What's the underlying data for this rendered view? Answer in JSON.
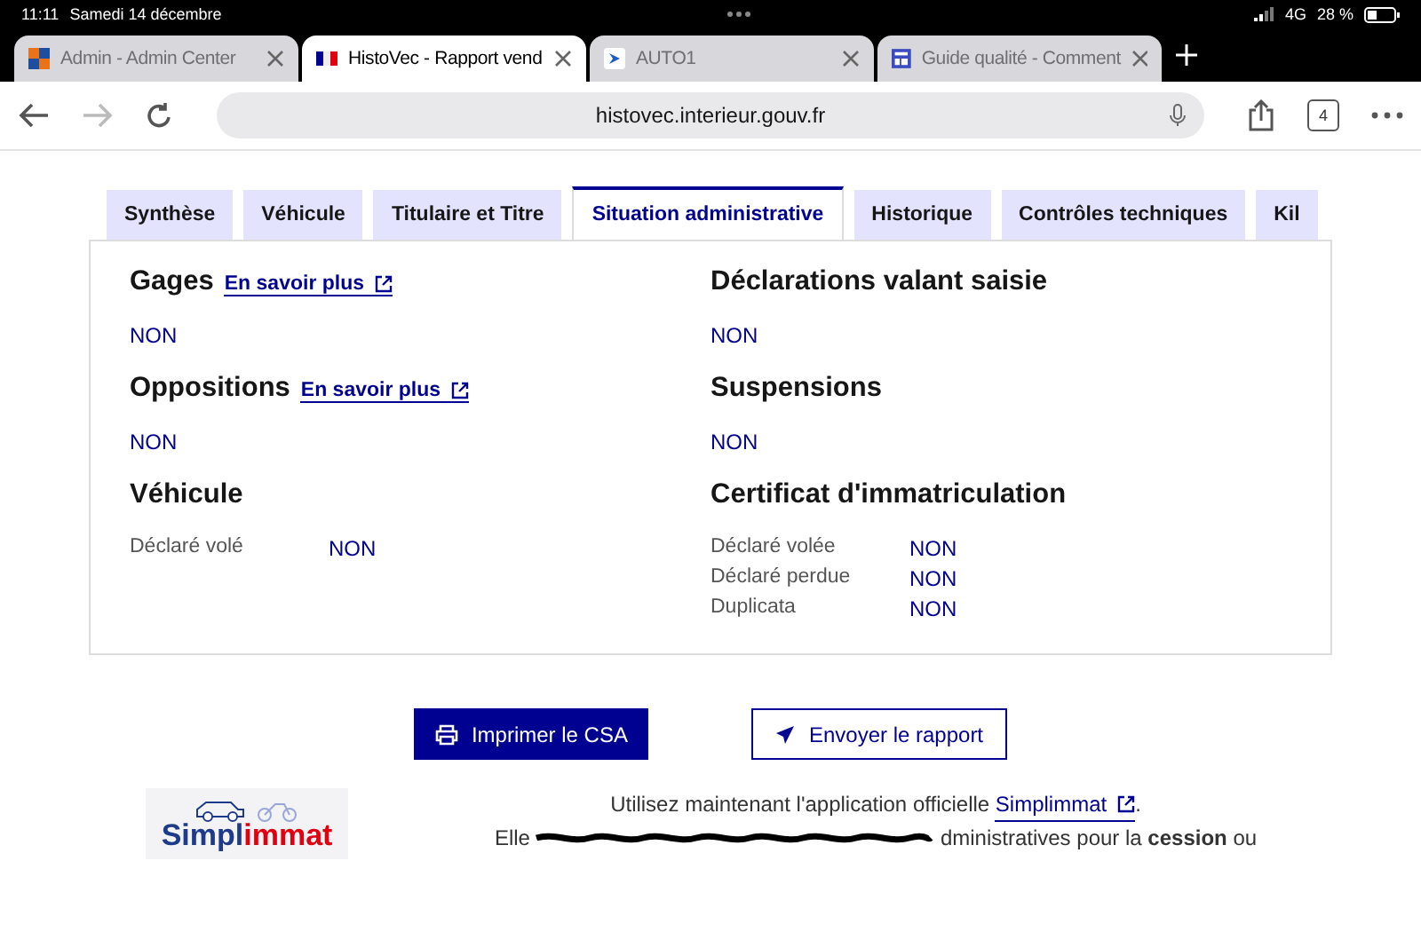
{
  "status_bar": {
    "time": "11:11",
    "date": "Samedi 14 décembre",
    "network": "4G",
    "battery": "28 %"
  },
  "browser_tabs": [
    {
      "title": "Admin - Admin Center",
      "selected": false
    },
    {
      "title": "HistoVec - Rapport vend",
      "selected": true
    },
    {
      "title": "AUTO1",
      "selected": false
    },
    {
      "title": "Guide qualité - Comment",
      "selected": false
    }
  ],
  "address_bar": {
    "url": "histovec.interieur.gouv.fr",
    "tab_count": "4"
  },
  "page_tabs": [
    {
      "label": "Synthèse",
      "selected": false
    },
    {
      "label": "Véhicule",
      "selected": false
    },
    {
      "label": "Titulaire et Titre",
      "selected": false
    },
    {
      "label": "Situation administrative",
      "selected": true
    },
    {
      "label": "Historique",
      "selected": false
    },
    {
      "label": "Contrôles techniques",
      "selected": false
    },
    {
      "label": "Kil",
      "selected": false
    }
  ],
  "columns": [
    {
      "sections": [
        {
          "title": "Gages",
          "link": "En savoir plus",
          "value": "NON"
        },
        {
          "title": "Oppositions",
          "link": "En savoir plus",
          "value": "NON"
        },
        {
          "title": "Véhicule",
          "rows": [
            {
              "label": "Déclaré volé",
              "value": "NON"
            }
          ]
        }
      ]
    },
    {
      "sections": [
        {
          "title": "Déclarations valant saisie",
          "value": "NON"
        },
        {
          "title": "Suspensions",
          "value": "NON"
        },
        {
          "title": "Certificat d'immatriculation",
          "rows": [
            {
              "label": "Déclaré volée",
              "value": "NON"
            },
            {
              "label": "Déclaré perdue",
              "value": "NON"
            },
            {
              "label": "Duplicata",
              "value": "NON"
            }
          ]
        }
      ]
    }
  ],
  "buttons": [
    {
      "label": "Imprimer le CSA",
      "kind": "primary"
    },
    {
      "label": "Envoyer le rapport",
      "kind": "secondary"
    }
  ],
  "promo": {
    "logo_text": "Simpl",
    "logo_accent": "immat",
    "line_1": "Utilisez maintenant l'application officielle",
    "link": "Simplimmat",
    "line_1_end": ".",
    "line_2_start": "Elle",
    "line_2_end": "dministratives pour la **cession** ou"
  }
}
